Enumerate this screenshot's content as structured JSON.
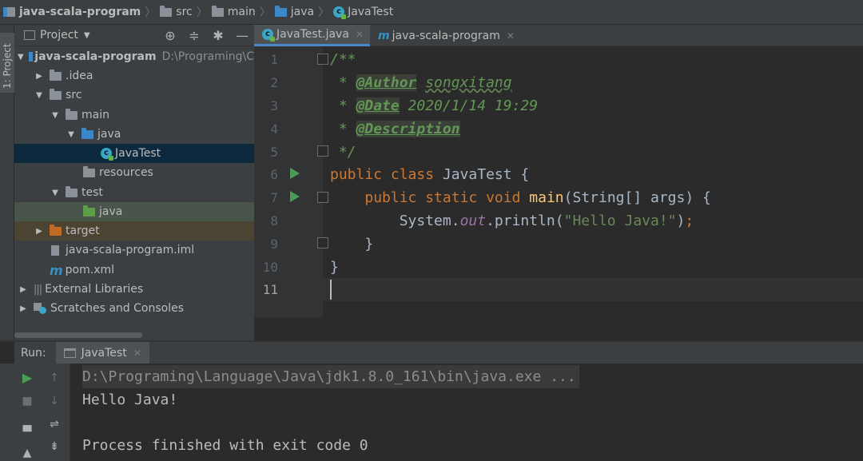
{
  "breadcrumb": {
    "project": "java-scala-program",
    "items": [
      "src",
      "main",
      "java",
      "JavaTest"
    ]
  },
  "left_stripe": {
    "label": "1: Project"
  },
  "project_panel": {
    "title": "Project",
    "tree": [
      {
        "label": "java-scala-program",
        "path": "D:\\Programing\\C",
        "arrow": "▼",
        "icon": "project-folder-icon"
      },
      {
        "label": ".idea",
        "arrow": "▶",
        "icon": "folder-icon"
      },
      {
        "label": "src",
        "arrow": "▼",
        "icon": "folder-icon"
      },
      {
        "label": "main",
        "arrow": "▼",
        "icon": "folder-icon"
      },
      {
        "label": "java",
        "arrow": "▼",
        "icon": "source-folder-icon"
      },
      {
        "label": "JavaTest",
        "arrow": "",
        "icon": "java-class-icon"
      },
      {
        "label": "resources",
        "arrow": "",
        "icon": "resources-folder-icon"
      },
      {
        "label": "test",
        "arrow": "▼",
        "icon": "folder-icon"
      },
      {
        "label": "java",
        "arrow": "",
        "icon": "test-folder-icon"
      },
      {
        "label": "target",
        "arrow": "▶",
        "icon": "excluded-folder-icon"
      },
      {
        "label": "java-scala-program.iml",
        "arrow": "",
        "icon": "iml-file-icon"
      },
      {
        "label": "pom.xml",
        "arrow": "",
        "icon": "maven-icon"
      },
      {
        "label": "External Libraries",
        "arrow": "▶",
        "icon": "libraries-icon"
      },
      {
        "label": "Scratches and Consoles",
        "arrow": "▶",
        "icon": "scratches-icon"
      }
    ]
  },
  "editor": {
    "tabs": [
      {
        "label": "JavaTest.java",
        "active": true
      },
      {
        "label": "java-scala-program",
        "active": false
      }
    ],
    "line_numbers": [
      "1",
      "2",
      "3",
      "4",
      "5",
      "6",
      "7",
      "8",
      "9",
      "10",
      "11"
    ],
    "current_line": "11",
    "code": {
      "l1": "/**",
      "l2_star": " * ",
      "l2_tag": "@Author",
      "l2_val": "songxitang",
      "l3_star": " * ",
      "l3_tag": "@Date",
      "l3_val": "2020/1/14 19:29",
      "l4_star": " * ",
      "l4_tag": "@Description",
      "l5": " */",
      "l6_kw": "public class",
      "l6_rest": " JavaTest {",
      "l7_indent": "    ",
      "l7_kw": "public static void",
      "l7_fn": "main",
      "l7_rest": "(String[] args) {",
      "l8_indent": "        ",
      "l8_obj": "System.",
      "l8_field": "out",
      "l8_call": ".println(",
      "l8_str": "\"Hello Java!\"",
      "l8_end": ");",
      "l8_semi": ";",
      "l9": "    }",
      "l10": "}"
    }
  },
  "run_panel": {
    "title": "Run:",
    "tab": "JavaTest",
    "console": [
      "D:\\Programing\\Language\\Java\\jdk1.8.0_161\\bin\\java.exe ...",
      "Hello Java!",
      "",
      "Process finished with exit code 0"
    ]
  },
  "colors": {
    "background": "#2b2b2b",
    "panel": "#3c3f41",
    "keyword": "#cc7832",
    "comment": "#629755",
    "function": "#ffc66d",
    "string": "#6a8759",
    "selection": "#0d293e"
  }
}
